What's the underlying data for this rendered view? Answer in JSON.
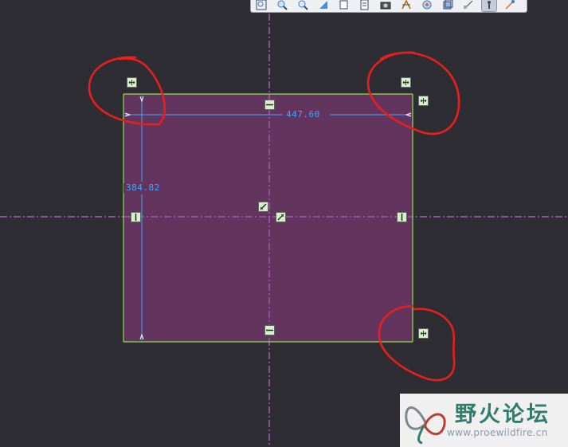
{
  "dimensions": {
    "width_value": "447.60",
    "height_value": "384.82"
  },
  "toolbar": {
    "buttons": [
      {
        "icon": "refit-icon"
      },
      {
        "icon": "zoom-in-icon"
      },
      {
        "icon": "zoom-out-icon"
      },
      {
        "icon": "repaint-icon"
      },
      {
        "icon": "view-orientation-icon"
      },
      {
        "icon": "saved-views-icon"
      },
      {
        "icon": "camera-icon"
      },
      {
        "icon": "datum-display-icon"
      },
      {
        "icon": "spin-center-icon"
      },
      {
        "icon": "display-style-icon"
      },
      {
        "icon": "sketch-view-icon"
      },
      {
        "icon": "sketcher-display-icon",
        "active": true
      },
      {
        "icon": "constraints-display-icon"
      }
    ]
  },
  "colors": {
    "background": "#2d2d33",
    "sketch_fill": "#64345f",
    "sketch_edge": "#8ee04e",
    "centerline": "#c267d6",
    "dimension": "#3aa7ff",
    "annotation_circle": "#e8201c",
    "handle_fill": "#d9f0d0"
  },
  "watermark": {
    "title": "野火论坛",
    "url": "www.proewildfire.cn"
  }
}
